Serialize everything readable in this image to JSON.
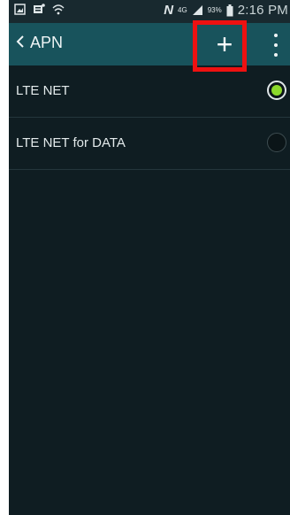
{
  "status_bar": {
    "time": "2:16 PM",
    "network": "4G",
    "battery": "93%",
    "icons": [
      "gallery-icon",
      "notification-icon",
      "wifi-icon",
      "nfc-icon",
      "signal-icon",
      "battery-icon"
    ]
  },
  "action_bar": {
    "title": "APN",
    "back_icon": "chevron-left-icon",
    "add_label": "+",
    "more_icon": "overflow-menu-icon",
    "highlight_color": "#ee1111"
  },
  "apn_list": [
    {
      "label": "LTE NET",
      "selected": true
    },
    {
      "label": "LTE NET for DATA",
      "selected": false
    }
  ],
  "colors": {
    "action_bar": "#18535c",
    "background": "#0f1d22",
    "radio_selected": "#8bd92b"
  }
}
